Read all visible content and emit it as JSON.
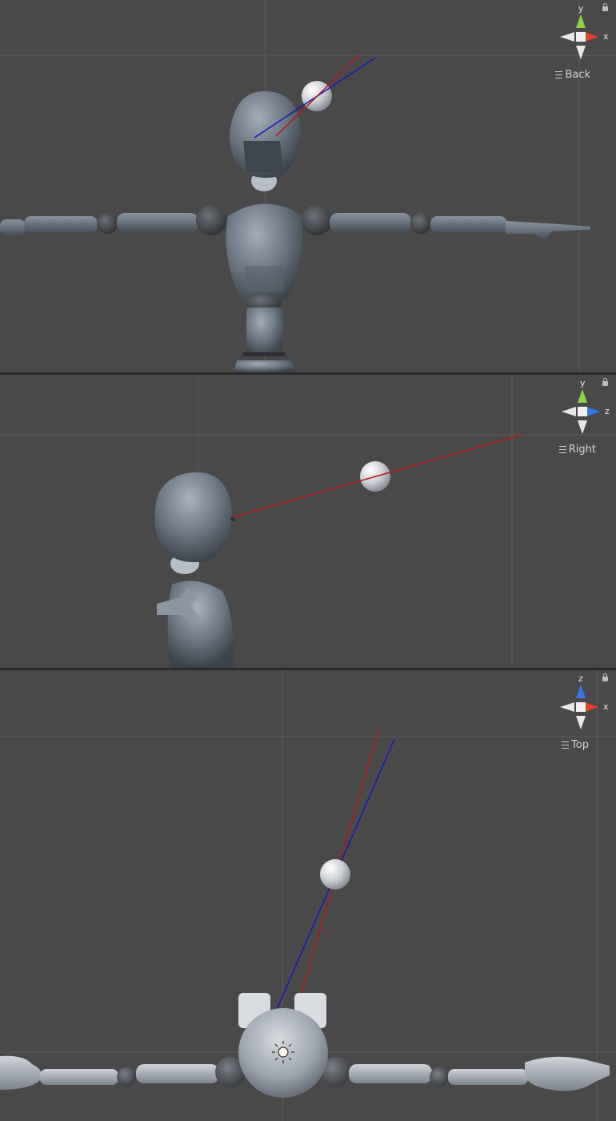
{
  "colors": {
    "background": "#494949",
    "grid": "#5a5a5a",
    "axis_x": "#e2442a",
    "axis_y": "#8fd140",
    "axis_z": "#3a74e6",
    "ray_red": "#b0181c",
    "ray_blue": "#1518b8",
    "body": "#707a86"
  },
  "viewports": [
    {
      "label": "Back",
      "axis_top": "y",
      "axis_side": "x"
    },
    {
      "label": "Right",
      "axis_top": "y",
      "axis_side": "z"
    },
    {
      "label": "Top",
      "axis_top": "z",
      "axis_side": "x"
    }
  ]
}
